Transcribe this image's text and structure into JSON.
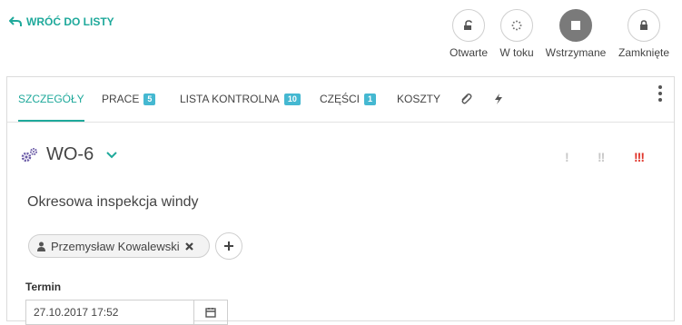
{
  "back_link": {
    "label": "WRÓĆ DO LISTY"
  },
  "statuses": [
    {
      "label": "Otwarte",
      "icon": "unlock-icon",
      "active": false
    },
    {
      "label": "W toku",
      "icon": "in-progress-icon",
      "active": false
    },
    {
      "label": "Wstrzymane",
      "icon": "stop-icon",
      "active": true
    },
    {
      "label": "Zamknięte",
      "icon": "lock-icon",
      "active": false
    }
  ],
  "tabs": [
    {
      "label": "SZCZEGÓŁY",
      "badge": "",
      "active": true
    },
    {
      "label": "PRACE",
      "badge": "5",
      "active": false
    },
    {
      "label": "LISTA KONTROLNA",
      "badge": "10",
      "active": false
    },
    {
      "label": "CZĘŚCI",
      "badge": "1",
      "active": false
    },
    {
      "label": "KOSZTY",
      "badge": "",
      "active": false
    }
  ],
  "tab_icons": [
    "paperclip-icon",
    "bolt-icon"
  ],
  "work_order": {
    "id": "WO-6",
    "icon": "gears-icon",
    "description": "Okresowa inspekcja windy",
    "assignee": "Przemysław Kowalewski",
    "due_label": "Termin",
    "due_value": "27.10.2017 17:52",
    "priorities": [
      "!",
      "!!",
      "!!!"
    ]
  },
  "colors": {
    "accent": "#1fa99b",
    "badge": "#45b8d1",
    "priority_high": "#e0342a",
    "status_active": "#7a7a7a"
  }
}
